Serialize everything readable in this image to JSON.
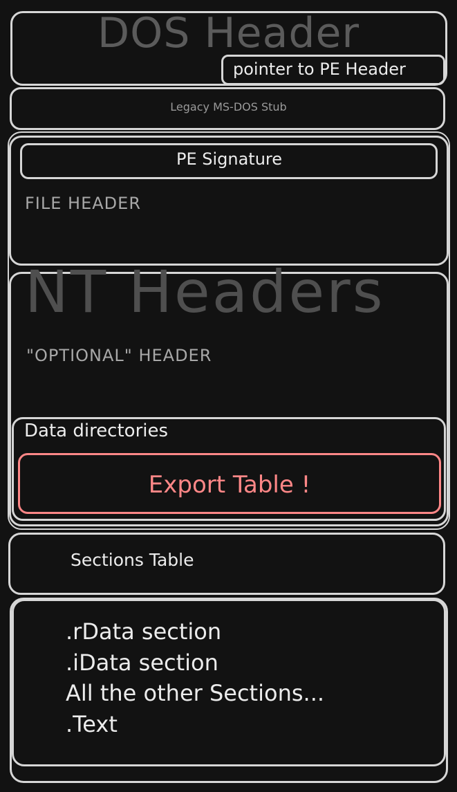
{
  "diagram": {
    "dos_header": "DOS Header",
    "pointer_to_pe": "pointer to PE Header",
    "dos_stub": "Legacy MS-DOS Stub",
    "pe_signature": "PE Signature",
    "file_header": "FILE HEADER",
    "nt_headers": "NT Headers",
    "optional_header": "\"OPTIONAL\" HEADER",
    "data_directories": "Data directories",
    "export_table": "Export Table !",
    "sections_table": "Sections Table",
    "sections": [
      ".rData section",
      ".iData section",
      "All the other Sections...",
      ".Text"
    ]
  },
  "colors": {
    "background": "#121212",
    "outline": "#d6d6d6",
    "highlight": "#ff8787"
  }
}
